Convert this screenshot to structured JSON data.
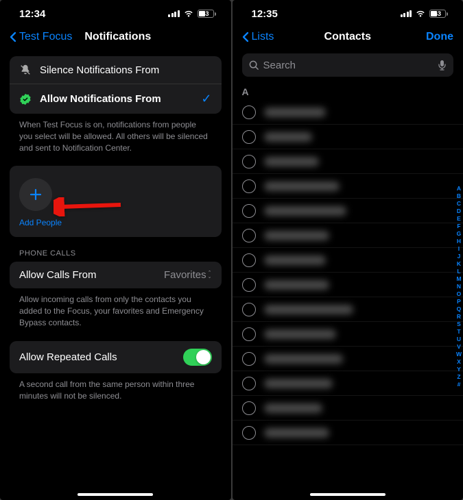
{
  "left": {
    "status": {
      "time": "12:34",
      "battery": "43"
    },
    "nav": {
      "back": "Test Focus",
      "title": "Notifications"
    },
    "mode_rows": {
      "silence": "Silence Notifications From",
      "allow": "Allow Notifications From"
    },
    "mode_footer": "When Test Focus is on, notifications from people you select will be allowed. All others will be silenced and sent to Notification Center.",
    "add_people_label": "Add People",
    "phone_calls_header": "PHONE CALLS",
    "allow_calls": {
      "label": "Allow Calls From",
      "value": "Favorites"
    },
    "allow_calls_footer": "Allow incoming calls from only the contacts you added to the Focus, your favorites and Emergency Bypass contacts.",
    "repeated": "Allow Repeated Calls",
    "repeated_footer": "A second call from the same person within three minutes will not be silenced."
  },
  "right": {
    "status": {
      "time": "12:35",
      "battery": "43"
    },
    "nav": {
      "back": "Lists",
      "title": "Contacts",
      "done": "Done"
    },
    "search_placeholder": "Search",
    "section_letter": "A",
    "index_letters": [
      "A",
      "B",
      "C",
      "D",
      "E",
      "F",
      "G",
      "H",
      "I",
      "J",
      "K",
      "L",
      "M",
      "N",
      "O",
      "P",
      "Q",
      "R",
      "S",
      "T",
      "U",
      "V",
      "W",
      "X",
      "Y",
      "Z",
      "#"
    ],
    "contact_widths": [
      90,
      70,
      80,
      110,
      120,
      95,
      90,
      95,
      130,
      105,
      115,
      100,
      85,
      95
    ]
  }
}
